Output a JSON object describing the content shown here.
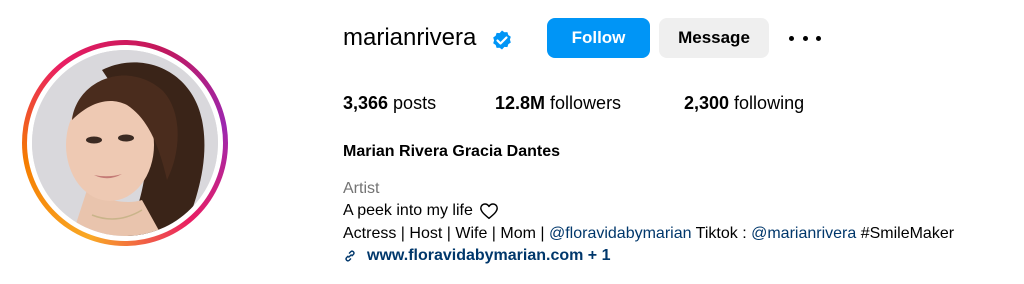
{
  "profile": {
    "username": "marianrivera",
    "verified_icon": "verified-badge-icon",
    "follow_label": "Follow",
    "message_label": "Message",
    "more_icon": "more-options-icon",
    "posts_count": "3,366",
    "posts_label": " posts",
    "followers_count": "12.8M",
    "followers_label": " followers",
    "following_count": "2,300",
    "following_label": " following",
    "full_name": "Marian Rivera Gracia Dantes",
    "category": "Artist",
    "bio_line1": "A peek into my life",
    "bio_line2_part1": "Actress | Host | Wife | Mom | ",
    "bio_mention1": "@floravidabymarian",
    "bio_line2_part2": " Tiktok : ",
    "bio_mention2": "@marianrivera",
    "bio_line2_part3": " #SmileMaker",
    "link_text": "www.floravidabymarian.com + 1",
    "colors": {
      "accent": "#0095f6",
      "link": "#00376b",
      "muted": "#737373",
      "button_secondary": "#efefef"
    }
  }
}
